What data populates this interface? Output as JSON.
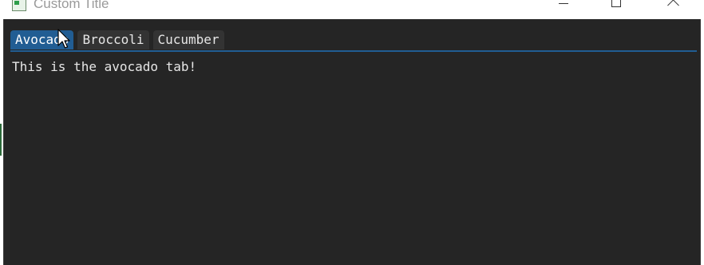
{
  "window": {
    "title": "Custom Title",
    "icon": "app-window-icon",
    "controls": {
      "minimize_icon": "minimize-icon",
      "maximize_icon": "maximize-icon",
      "close_icon": "close-icon"
    }
  },
  "tabs": [
    {
      "label": "Avocado",
      "active": true
    },
    {
      "label": "Broccoli",
      "active": false
    },
    {
      "label": "Cucumber",
      "active": false
    }
  ],
  "content": {
    "text": "This is the avocado tab!"
  },
  "colors": {
    "client_background": "#252525",
    "tab_active": "#215d93",
    "tab_inactive": "#333333",
    "text": "#e6e6e6"
  }
}
